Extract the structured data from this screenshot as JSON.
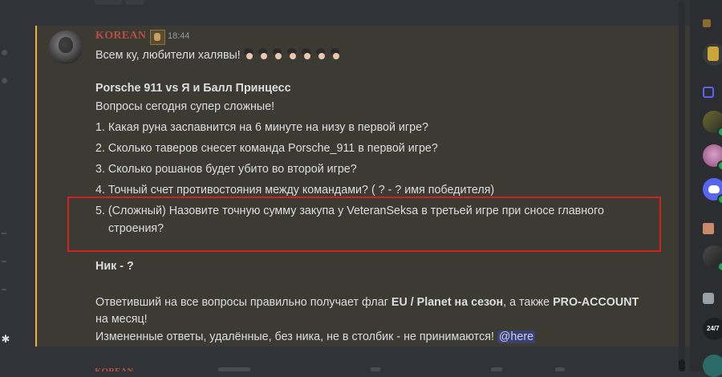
{
  "message": {
    "username": "KOREAN",
    "timestamp": "18:44",
    "greeting": "Всем ку, любители халявы!",
    "title": "Porsche 911 vs  Я и Балл Принцесс",
    "intro": "Вопросы сегодня супер сложные!",
    "questions": [
      "1. Какая руна заспавнится на 6 минуте на низу в первой игре?",
      "2. Сколько таверов снесет команда Porsche_911 в первой игре?",
      "3. Сколько рошанов будет убито во второй игре?",
      "4. Точный счет противостояния между командами? ( ? - ? имя победителя)",
      "5. (Сложный) Назовите точную сумму закупа у VeteranSeksa в третьей игре при сносе главного"
    ],
    "question5_cont": "строения?",
    "nick_line": "Ник - ?",
    "prize_part1": "Ответивший на все вопросы правильно получает флаг ",
    "prize_bold1": "EU / Planet на сезон",
    "prize_part2": ", а также ",
    "prize_bold2": "PRO-ACCOUNT",
    "prize_cont": "на месяц!",
    "rules": "Измененные ответы, удалённые, без ника, не в столбик - не принимаются! ",
    "mention": "@here"
  },
  "next_message": {
    "username": "KOREAN"
  },
  "colors": {
    "background": "#313338",
    "message_highlight": "#3b3a33",
    "mention_bar": "#f0b232",
    "username": "#b84e44",
    "annotation_box": "#d61f1f",
    "online": "#23a55a"
  }
}
